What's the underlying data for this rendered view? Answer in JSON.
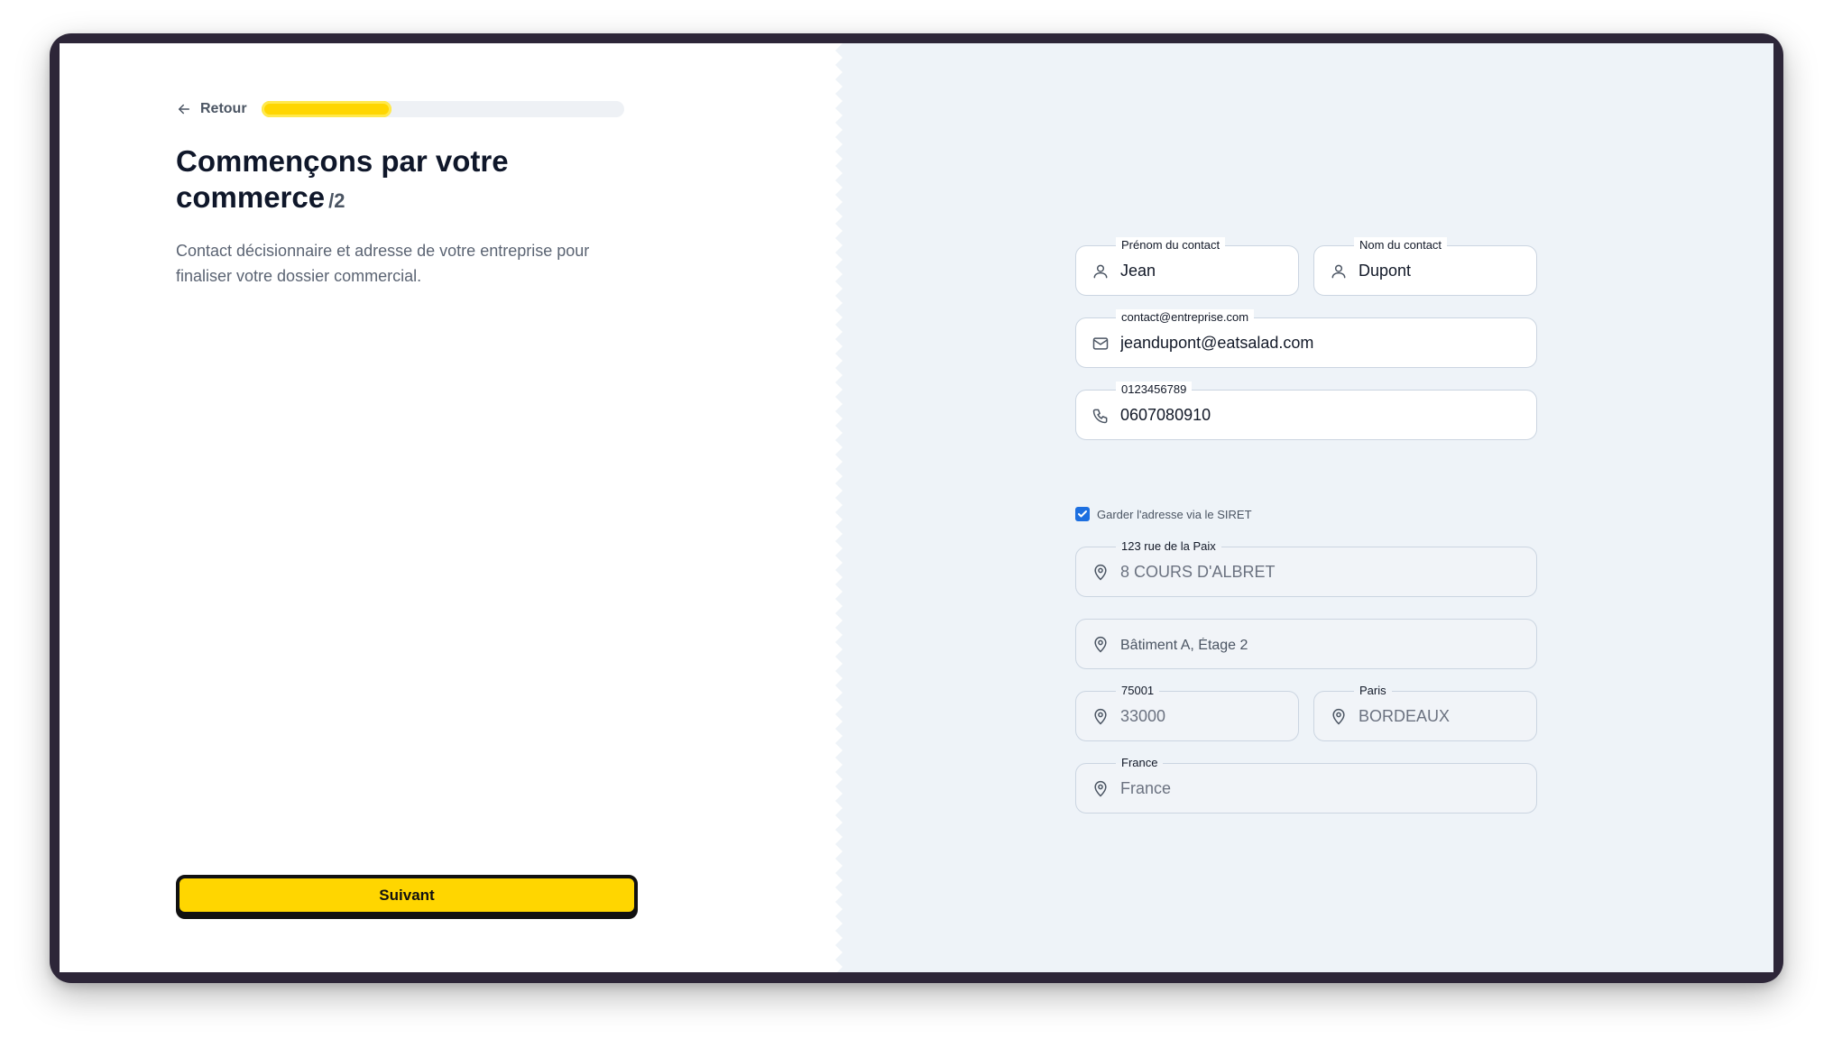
{
  "left": {
    "back_label": "Retour",
    "progress": 0.36,
    "title": "Commençons par votre commerce",
    "step": "/2",
    "subtitle": "Contact décisionnaire et adresse de votre entreprise pour finaliser votre dossier commercial.",
    "next_label": "Suivant"
  },
  "form": {
    "first_name": {
      "label": "Prénom du contact",
      "value": "Jean",
      "icon": "user-icon"
    },
    "last_name": {
      "label": "Nom du contact",
      "value": "Dupont",
      "icon": "user-icon"
    },
    "email": {
      "label": "contact@entreprise.com",
      "value": "jeandupont@eatsalad.com",
      "icon": "mail-icon"
    },
    "phone": {
      "label": "0123456789",
      "value": "0607080910",
      "icon": "phone-icon"
    },
    "siret_checkbox": {
      "label": "Garder l'adresse via le SIRET",
      "checked": true
    },
    "address": {
      "label": "123 rue de la Paix",
      "value": "8 COURS D'ALBRET",
      "icon": "location-pin-icon"
    },
    "address2": {
      "placeholder": "Bâtiment A, Étage 2",
      "icon": "location-pin-icon"
    },
    "postal_code": {
      "label": "75001",
      "value": "33000",
      "icon": "location-pin-icon"
    },
    "city": {
      "label": "Paris",
      "value": "BORDEAUX",
      "icon": "location-pin-icon"
    },
    "country": {
      "label": "France",
      "value": "France",
      "icon": "location-pin-icon"
    }
  },
  "colors": {
    "accent": "#ffd600",
    "right_background": "#eef3f8",
    "checkbox": "#1d6fe0",
    "frame": "#2d2638"
  }
}
